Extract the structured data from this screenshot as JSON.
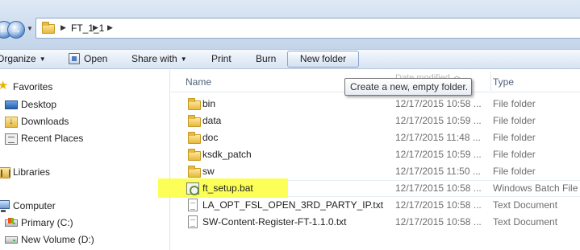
{
  "address_bar": {
    "breadcrumb": "FT_1_1",
    "back_icon": "back-arrow-icon",
    "forward_icon": "forward-arrow-icon"
  },
  "toolbar": {
    "organize_label": "Organize",
    "open_label": "Open",
    "share_with_label": "Share with",
    "print_label": "Print",
    "burn_label": "Burn",
    "new_folder_label": "New folder"
  },
  "tooltip": {
    "text": "Create a new, empty folder."
  },
  "nav_pane": {
    "favorites": {
      "label": "Favorites",
      "items": [
        {
          "label": "Desktop",
          "icon": "desktop-icon"
        },
        {
          "label": "Downloads",
          "icon": "downloads-icon"
        },
        {
          "label": "Recent Places",
          "icon": "recent-places-icon"
        }
      ]
    },
    "libraries": {
      "label": "Libraries",
      "icon": "libraries-icon"
    },
    "computer": {
      "label": "Computer",
      "items": [
        {
          "label": "Primary (C:)",
          "icon": "drive-icon"
        },
        {
          "label": "New Volume (D:)",
          "icon": "drive-icon"
        }
      ]
    }
  },
  "columns": {
    "name": "Name",
    "date_modified": "Date modified",
    "type": "Type"
  },
  "files": [
    {
      "name": "bin",
      "date": "12/17/2015 10:58 ...",
      "type": "File folder",
      "icon": "folder-icon"
    },
    {
      "name": "data",
      "date": "12/17/2015 10:59 ...",
      "type": "File folder",
      "icon": "folder-icon"
    },
    {
      "name": "doc",
      "date": "12/17/2015 11:48 ...",
      "type": "File folder",
      "icon": "folder-icon"
    },
    {
      "name": "ksdk_patch",
      "date": "12/17/2015 10:59 ...",
      "type": "File folder",
      "icon": "folder-icon"
    },
    {
      "name": "sw",
      "date": "12/17/2015 11:50 ...",
      "type": "File folder",
      "icon": "folder-icon"
    },
    {
      "name": "ft_setup.bat",
      "date": "12/17/2015 10:58 ...",
      "type": "Windows Batch File",
      "icon": "batch-file-icon",
      "highlighted": true
    },
    {
      "name": "LA_OPT_FSL_OPEN_3RD_PARTY_IP.txt",
      "date": "12/17/2015 10:58 ...",
      "type": "Text Document",
      "icon": "text-file-icon"
    },
    {
      "name": "SW-Content-Register-FT-1.1.0.txt",
      "date": "12/17/2015 10:58 ...",
      "type": "Text Document",
      "icon": "text-file-icon"
    }
  ],
  "colors": {
    "highlight": "#fbff4f",
    "toolbar_bg": "#e3ecf7",
    "header_text": "#4c607a"
  }
}
